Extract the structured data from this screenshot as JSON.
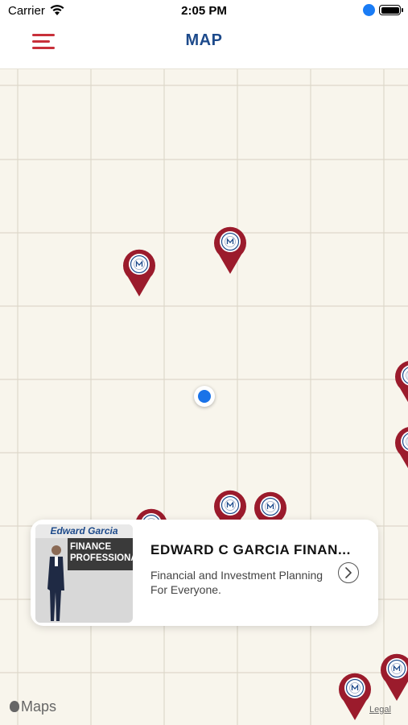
{
  "status_bar": {
    "carrier": "Carrier",
    "time": "2:05 PM"
  },
  "nav": {
    "title": "MAP",
    "menu_icon": "hamburger-menu-icon",
    "accent_color": "#c8303a",
    "title_color": "#1d4a8b"
  },
  "map": {
    "background_color": "#f8f5ec",
    "pin_color": "#9b1b2c",
    "pin_icon": "location-pin-icon",
    "user_location_icon": "user-location-dot"
  },
  "card": {
    "image": {
      "name": "Edward Garcia",
      "banner_line1": "FINANCE",
      "banner_line2": "PROFESSIONAL"
    },
    "title": "EDWARD C GARCIA FINAN...",
    "description": "Financial and Investment Planning For Everyone.",
    "chevron_icon": "chevron-right-icon"
  },
  "attribution": {
    "maps_label": "Maps",
    "legal_label": "Legal"
  }
}
